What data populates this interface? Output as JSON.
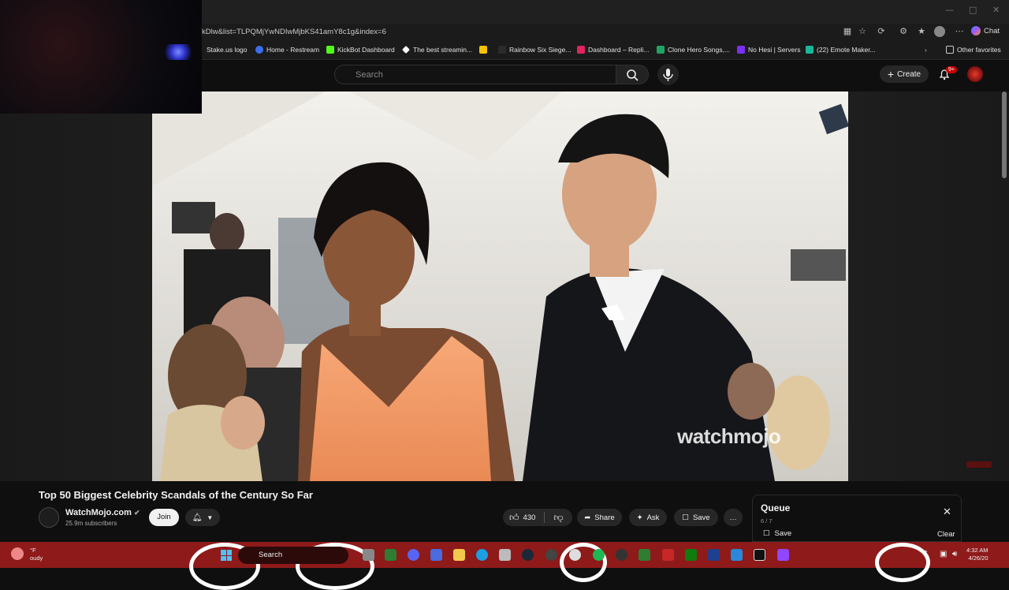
{
  "browser": {
    "url": "kDlw&list=TLPQMjYwNDIwMjbKS41amY8c1g&index=6",
    "chat_label": "Chat",
    "bookmarks": [
      {
        "label": "Stake.us logo",
        "color": "#2b2b2b"
      },
      {
        "label": "Home - Restream",
        "color": "#3a6df0"
      },
      {
        "label": "KickBot Dashboard",
        "color": "#53fc18"
      },
      {
        "label": "The best streamin...",
        "color": "#ffffff"
      },
      {
        "label": "",
        "color": "#f5c400"
      },
      {
        "label": "Rainbow Six Siege...",
        "color": "#2b2b2b"
      },
      {
        "label": "Dashboard – Repli...",
        "color": "#e0245e"
      },
      {
        "label": "Clone Hero Songs,...",
        "color": "#1fa463"
      },
      {
        "label": "No Hesi | Servers",
        "color": "#7b2ff7"
      },
      {
        "label": "(22) Emote Maker...",
        "color": "#19b79a"
      }
    ],
    "other_favorites": "Other favorites"
  },
  "youtube": {
    "search_placeholder": "Search",
    "create_label": "Create",
    "notification_badge": "9+"
  },
  "video": {
    "title": "Top 50 Biggest Celebrity Scandals of the Century So Far",
    "watermark": "watchmojo",
    "channel": "WatchMojo.com",
    "subscribers": "25.9m subscribers",
    "join_label": "Join",
    "likes": "430",
    "share_label": "Share",
    "ask_label": "Ask",
    "save_label": "Save",
    "more_label": "…"
  },
  "queue": {
    "title": "Queue",
    "count": "6 / 7",
    "save_label": "Save",
    "clear_label": "Clear"
  },
  "taskbar": {
    "search_label": "Search",
    "weather_temp": "°F",
    "weather_desc": "oudy",
    "time": "4:32 AM",
    "date": "4/26/20"
  },
  "colors": {
    "youtube_bg": "#0f0f0f",
    "accent_red": "#cc0000",
    "taskbar": "#8e1a1a"
  }
}
